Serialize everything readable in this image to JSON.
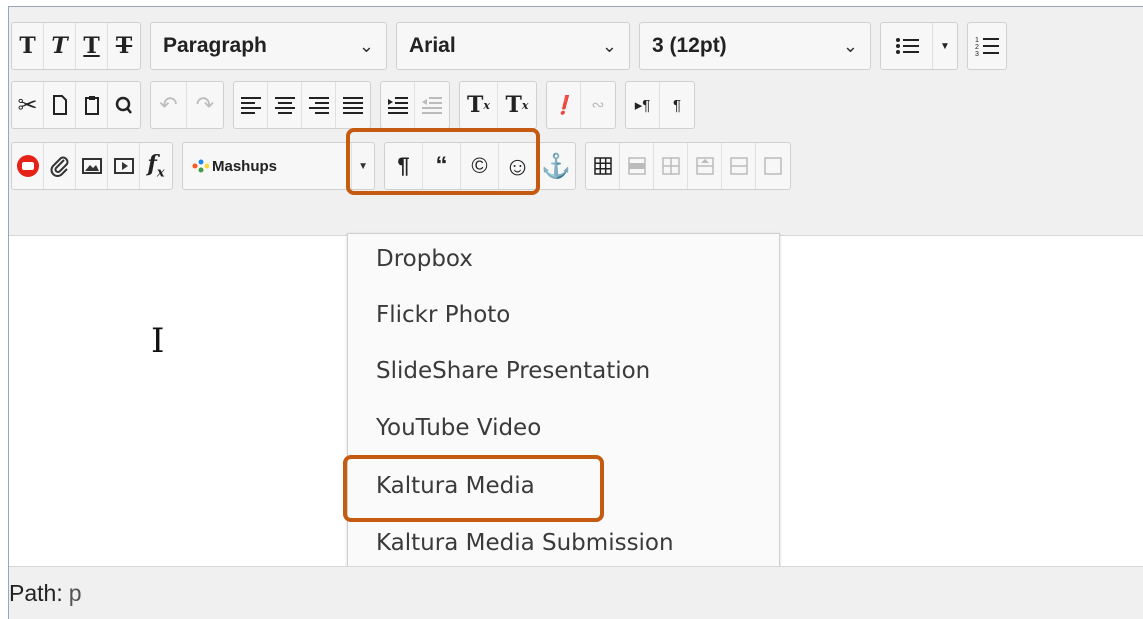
{
  "toolbar": {
    "row1": {
      "format_select": "Paragraph",
      "font_select": "Arial",
      "size_select": "3 (12pt)"
    },
    "row3": {
      "mashups_label": "Mashups"
    }
  },
  "mashups_menu": {
    "items": [
      "Dropbox",
      "Flickr Photo",
      "SlideShare Presentation",
      "YouTube Video",
      "Kaltura Media",
      "Kaltura Media Submission"
    ]
  },
  "status_bar": {
    "label": "Path:",
    "value": "p"
  },
  "colors": {
    "highlight": "#c55a11",
    "toolbar_bg": "#f0f0f0",
    "youtube_red": "#e62117"
  }
}
